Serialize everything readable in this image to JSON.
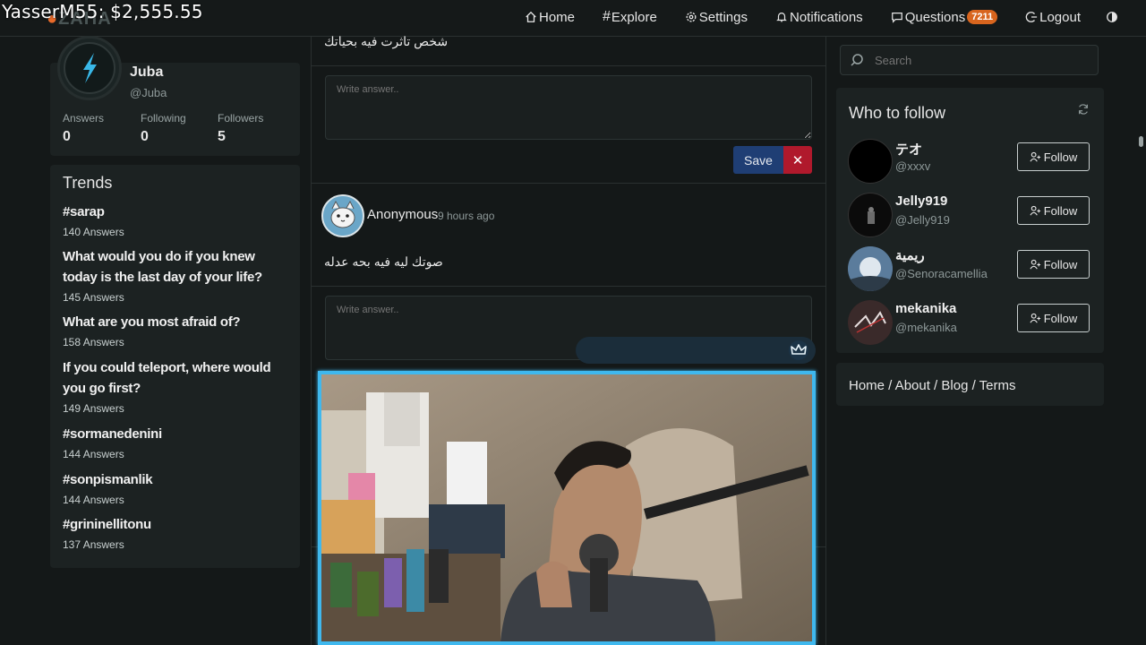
{
  "overlay": {
    "text": "YasserM55: $2,555.55"
  },
  "brand": {
    "logo_text": "ZAHA"
  },
  "nav": {
    "home": "Home",
    "explore": "Explore",
    "settings": "Settings",
    "notifications": "Notifications",
    "questions": "Questions",
    "questions_badge": "7211",
    "logout": "Logout"
  },
  "profile": {
    "name": "Juba",
    "handle": "@Juba",
    "stats": [
      {
        "label": "Answers",
        "value": "0"
      },
      {
        "label": "Following",
        "value": "0"
      },
      {
        "label": "Followers",
        "value": "5"
      }
    ]
  },
  "trends": {
    "title": "Trends",
    "items": [
      {
        "title": "#sarap",
        "count": "140 Answers"
      },
      {
        "title": "What would you do if you knew today is the last day of your life?",
        "count": "145 Answers"
      },
      {
        "title": "What are you most afraid of?",
        "count": "158 Answers"
      },
      {
        "title": "If you could teleport, where would you go first?",
        "count": "149 Answers"
      },
      {
        "title": "#sormanedenini",
        "count": "144 Answers"
      },
      {
        "title": "#sonpismanlik",
        "count": "144 Answers"
      },
      {
        "title": "#grininellitonu",
        "count": "137 Answers"
      }
    ]
  },
  "feed": {
    "question_1": "شخص تاثرت فيه بحياتك",
    "answer_placeholder": "Write answer..",
    "save_label": "Save",
    "cancel_label": "✕",
    "post_2": {
      "author": "Anonymous",
      "time": "9 hours ago",
      "question": "صوتك ليه فيه بحه عدله"
    }
  },
  "sidebar": {
    "search_placeholder": "Search",
    "who_to_follow_title": "Who to follow",
    "follow_label": "Follow",
    "users": [
      {
        "name": "テオ",
        "handle": "@xxxv"
      },
      {
        "name": "Jelly919",
        "handle": "@Jelly919"
      },
      {
        "name": "ريمية",
        "handle": "@Senoracamellia"
      },
      {
        "name": "mekanika",
        "handle": "@mekanika"
      }
    ],
    "footer_links": "Home / About / Blog / Terms"
  }
}
